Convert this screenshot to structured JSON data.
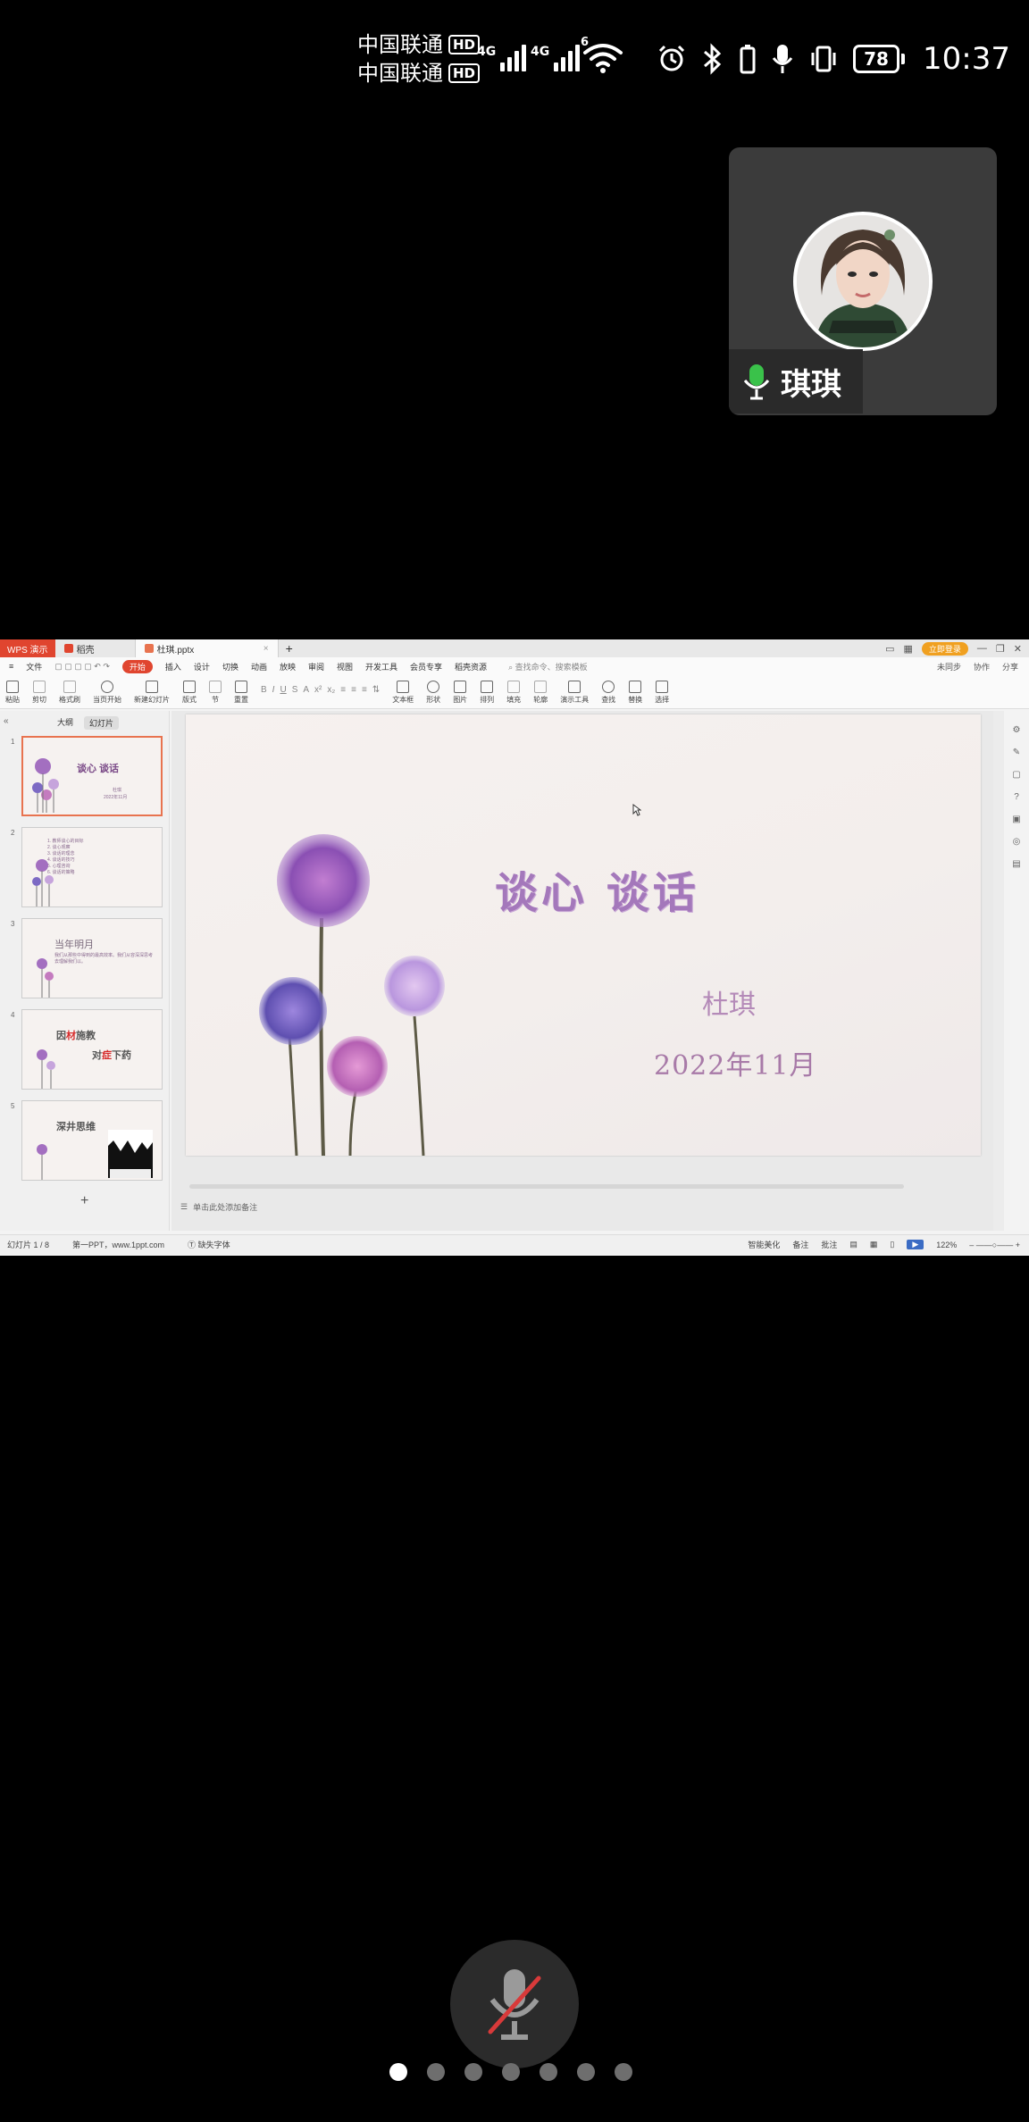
{
  "status_bar": {
    "carrier_1": "中国联通",
    "carrier_2": "中国联通",
    "hd_badge": "HD",
    "network_1": "4G",
    "network_2": "4G",
    "wifi_label": "6",
    "battery": "78",
    "time": "10:37",
    "icons": [
      "alarm-icon",
      "bluetooth-icon",
      "battery-saver-icon",
      "mic-icon",
      "vibrate-icon"
    ]
  },
  "call": {
    "participant_name": "琪琪",
    "mic_state": "on",
    "local_mic_state": "muted",
    "page_count": 7,
    "active_page": 1
  },
  "wps": {
    "tabs": [
      "WPS 演示",
      "稻壳",
      "杜琪.pptx"
    ],
    "login_label": "立即登录",
    "menu": [
      "文件",
      "开始",
      "插入",
      "设计",
      "切换",
      "动画",
      "放映",
      "审阅",
      "视图",
      "开发工具",
      "会员专享",
      "稻壳资源"
    ],
    "menu_active": "开始",
    "menu_search": "查找命令、搜索模板",
    "menu_right": [
      "未同步",
      "协作",
      "分享"
    ],
    "ribbon": [
      "粘贴",
      "剪切",
      "格式刷",
      "当页开始",
      "新建幻灯片",
      "版式",
      "节",
      "重置",
      "文本框",
      "形状",
      "排列",
      "轮廓",
      "演示工具",
      "替换",
      "选择"
    ],
    "ribbon_extra": [
      "图片",
      "填充",
      "查找"
    ],
    "pane_tabs": [
      "大纲",
      "幻灯片"
    ],
    "pane_active": "幻灯片",
    "thumbnails": [
      {
        "num": "1",
        "title": "谈心 谈话",
        "sub": "杜琪",
        "sub2": "2022年11月"
      },
      {
        "num": "2",
        "lines": [
          "1. 教师谈心的目标",
          "2. 谈心观察",
          "3. 谈话的理念",
          "4. 谈话的技巧",
          "5. 心理咨询",
          "6. 谈话的策略"
        ]
      },
      {
        "num": "3",
        "title": "当年明月",
        "sub": "我们从那些中得到的最高效率。我们从容深深思考去理解我们以。"
      },
      {
        "num": "4",
        "title_a": "因",
        "title_b": "材",
        "title_c": "施教",
        "title_d": "对",
        "title_e": "症",
        "title_f": "下药"
      },
      {
        "num": "5",
        "title": "深井思维"
      }
    ],
    "slide": {
      "title": "谈心  谈话",
      "author": "杜琪",
      "date": "2022年11月"
    },
    "notes_placeholder": "单击此处添加备注",
    "status": {
      "slide_counter": "幻灯片 1 / 8",
      "theme": "第一PPT，www.1ppt.com",
      "font_missing": "缺失字体",
      "beautify": "智能美化",
      "notes": "备注",
      "comments": "批注",
      "zoom": "122%"
    }
  }
}
